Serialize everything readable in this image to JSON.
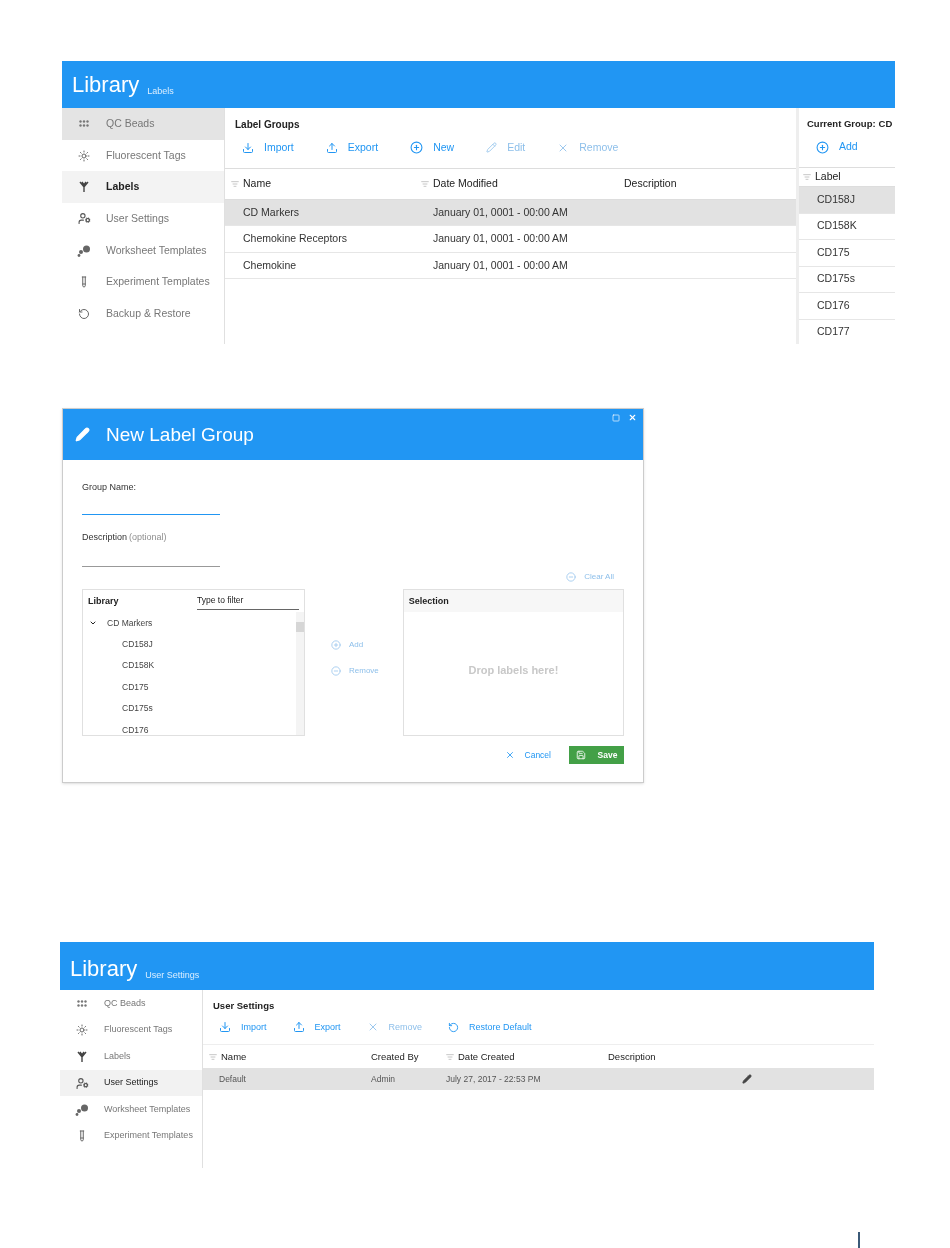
{
  "library_labels": {
    "header": {
      "title": "Library",
      "subtitle": "Labels"
    },
    "sidebar": [
      {
        "label": "QC Beads",
        "selected": false,
        "hovered": true
      },
      {
        "label": "Fluorescent Tags",
        "selected": false,
        "hovered": false
      },
      {
        "label": "Labels",
        "selected": true,
        "hovered": false
      },
      {
        "label": "User Settings",
        "selected": false,
        "hovered": false
      },
      {
        "label": "Worksheet Templates",
        "selected": false,
        "hovered": false
      },
      {
        "label": "Experiment Templates",
        "selected": false,
        "hovered": false
      },
      {
        "label": "Backup & Restore",
        "selected": false,
        "hovered": false
      }
    ],
    "label_groups": {
      "title": "Label Groups",
      "toolbar": [
        {
          "label": "Import",
          "disabled": false
        },
        {
          "label": "Export",
          "disabled": false
        },
        {
          "label": "New",
          "disabled": false
        },
        {
          "label": "Edit",
          "disabled": true
        },
        {
          "label": "Remove",
          "disabled": true
        }
      ],
      "columns": [
        {
          "label": "Name",
          "sortable": true
        },
        {
          "label": "Date Modified",
          "sortable": true
        },
        {
          "label": "Description",
          "sortable": false
        }
      ],
      "rows": [
        {
          "cells": [
            "CD Markers",
            "January 01, 0001 - 00:00 AM",
            ""
          ],
          "selected": true
        },
        {
          "cells": [
            "Chemokine Receptors",
            "January 01, 0001 - 00:00 AM",
            ""
          ],
          "selected": false
        },
        {
          "cells": [
            "Chemokine",
            "January 01, 0001 - 00:00 AM",
            ""
          ],
          "selected": false
        }
      ]
    },
    "current_group": {
      "title": "Current Group:",
      "group": "CD",
      "toolbar": [
        {
          "label": "Add",
          "disabled": false
        }
      ],
      "column": {
        "label": "Label",
        "sortable": true
      },
      "rows": [
        {
          "label": "CD158J",
          "selected": true
        },
        {
          "label": "CD158K",
          "selected": false
        },
        {
          "label": "CD175",
          "selected": false
        },
        {
          "label": "CD175s",
          "selected": false
        },
        {
          "label": "CD176",
          "selected": false
        },
        {
          "label": "CD177",
          "selected": false
        }
      ]
    }
  },
  "new_label_group_dialog": {
    "title": "New Label Group",
    "group_name": {
      "label": "Group Name:",
      "focused": true
    },
    "description": {
      "label": "Description",
      "hint": "(optional)"
    },
    "clear_all": {
      "label": "Clear All",
      "disabled": true
    },
    "library": {
      "title": "Library",
      "filter_placeholder": "Type to filter",
      "tree": [
        {
          "label": "CD Markers",
          "expanded": true,
          "children": [
            {
              "label": "CD158J"
            },
            {
              "label": "CD158K"
            },
            {
              "label": "CD175"
            },
            {
              "label": "CD175s"
            },
            {
              "label": "CD176"
            }
          ]
        }
      ]
    },
    "transfer_buttons": [
      {
        "label": "Add",
        "disabled": true
      },
      {
        "label": "Remove",
        "disabled": true
      }
    ],
    "selection": {
      "title": "Selection",
      "empty_text": "Drop labels here!"
    },
    "buttons": [
      {
        "label": "Cancel",
        "kind": "cancel"
      },
      {
        "label": "Save",
        "kind": "save"
      }
    ]
  },
  "library_user_settings": {
    "header": {
      "title": "Library",
      "subtitle": "User Settings"
    },
    "sidebar": [
      {
        "label": "QC Beads",
        "selected": false,
        "hovered": false
      },
      {
        "label": "Fluorescent Tags",
        "selected": false,
        "hovered": false
      },
      {
        "label": "Labels",
        "selected": false,
        "hovered": false
      },
      {
        "label": "User Settings",
        "selected": true,
        "hovered": false
      },
      {
        "label": "Worksheet Templates",
        "selected": false,
        "hovered": false
      },
      {
        "label": "Experiment Templates",
        "selected": false,
        "hovered": false
      }
    ],
    "panel": {
      "title": "User Settings",
      "toolbar": [
        {
          "label": "Import",
          "disabled": false
        },
        {
          "label": "Export",
          "disabled": false
        },
        {
          "label": "Remove",
          "disabled": true
        },
        {
          "label": "Restore Default",
          "disabled": false
        }
      ],
      "columns": [
        {
          "label": "Name",
          "sortable": true
        },
        {
          "label": "Created By",
          "sortable": false
        },
        {
          "label": "Date Created",
          "sortable": true
        },
        {
          "label": "Description",
          "sortable": false
        }
      ],
      "rows": [
        {
          "cells": [
            "Default",
            "Admin",
            "July 27, 2017 - 22:53 PM",
            ""
          ],
          "selected": true,
          "editable": true
        }
      ]
    }
  }
}
